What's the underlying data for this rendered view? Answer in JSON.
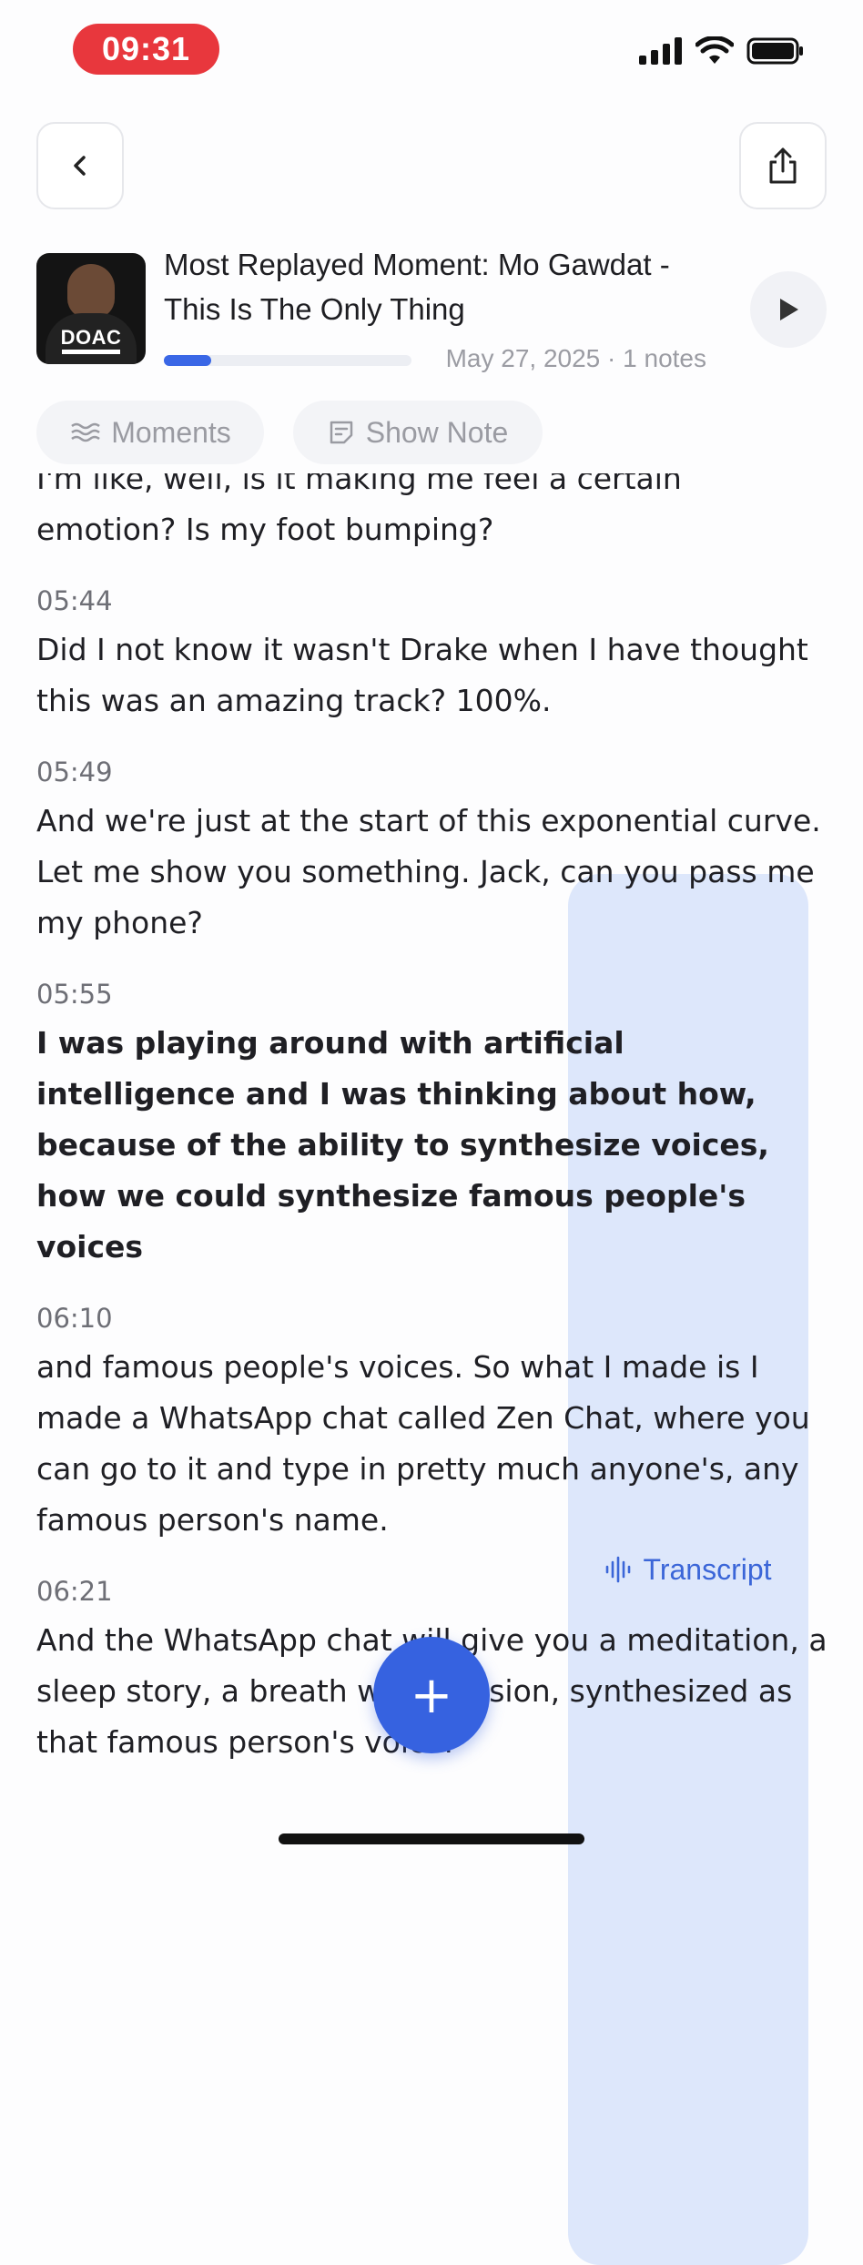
{
  "status_bar": {
    "time": "09:31"
  },
  "header": {
    "back_icon": "chevron-left-icon",
    "share_icon": "share-icon"
  },
  "episode": {
    "artwork_label": "DOAC",
    "title": "Most Replayed Moment: Mo Gawdat - This Is The Only Thing",
    "date": "May 27, 2025",
    "separator": "·",
    "notes": "1 notes",
    "progress": 0.19,
    "accent_color": "#3a67e6"
  },
  "tabs": [
    {
      "label": "Moments",
      "icon": "waves-icon",
      "active": false
    },
    {
      "label": "Show Note",
      "icon": "note-icon",
      "active": false
    },
    {
      "label": "Transcript",
      "icon": "soundwave-icon",
      "active": true
    }
  ],
  "transcript": [
    {
      "time": "",
      "text": "I'm like, well, is it making me feel a certain emotion? Is my foot bumping?",
      "bold": false
    },
    {
      "time": "05:44",
      "text": "Did I not know it wasn't Drake when I have thought this was an amazing track? 100%.",
      "bold": false
    },
    {
      "time": "05:49",
      "text": "And we're just at the start of this exponential curve. Let me show you something. Jack, can you pass me my phone?",
      "bold": false
    },
    {
      "time": "05:55",
      "text": "I was playing around with artificial intelligence and I was thinking about how, because of the ability to synthesize voices, how we could synthesize famous people's voices",
      "bold": true
    },
    {
      "time": "06:10",
      "text": "and famous people's voices. So what I made is I made a WhatsApp chat called Zen Chat, where you can go to it and type in pretty much anyone's, any famous person's name.",
      "bold": false
    },
    {
      "time": "06:21",
      "text": "And the WhatsApp chat will give you a meditation, a sleep story, a breath work session, synthesized as that famous person's voice.",
      "bold": false
    }
  ],
  "fab": {
    "label": "+"
  }
}
